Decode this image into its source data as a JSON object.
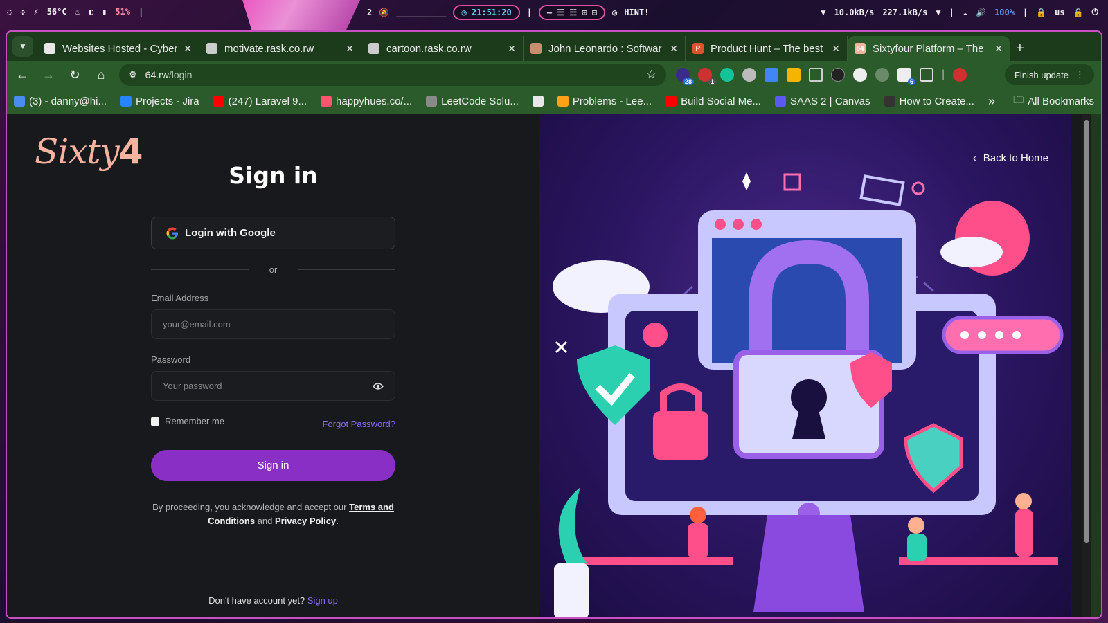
{
  "system_bar": {
    "temp": "56°C",
    "battery": "51%",
    "workspace": "2",
    "clock": "21:51:20",
    "hint": "HINT!",
    "net_up": "10.0kB/s",
    "net_down": "227.1kB/s",
    "volume": "100%",
    "layout": "us",
    "dashes": "__________"
  },
  "tabs": [
    {
      "title": "Websites Hosted - Cyber",
      "favicon": "doc-icon",
      "color": "#e8e8e8"
    },
    {
      "title": "motivate.rask.co.rw",
      "favicon": "globe-icon",
      "color": "#cccccc"
    },
    {
      "title": "cartoon.rask.co.rw",
      "favicon": "globe-icon",
      "color": "#cccccc"
    },
    {
      "title": "John Leonardo : Softwar",
      "favicon": "person-icon",
      "color": "#c89070"
    },
    {
      "title": "Product Hunt – The best",
      "favicon": "product-hunt-icon",
      "color": "#da552f",
      "letter": "P"
    },
    {
      "title": "Sixtyfour Platform – The",
      "favicon": "sixtyfour-icon",
      "color": "#f6b4a0",
      "letter": "64",
      "active": true
    }
  ],
  "toolbar": {
    "url_host": "64.rw",
    "url_path": "/login",
    "finish_update": "Finish update",
    "ext_badge_1": "28",
    "ext_badge_2": "1",
    "ext_badge_3": "6"
  },
  "bookmarks": [
    {
      "label": "(3) - danny@hi...",
      "color": "#4a8df0"
    },
    {
      "label": "Projects - Jira",
      "color": "#2684ff"
    },
    {
      "label": "(247) Laravel 9...",
      "color": "#ff0000"
    },
    {
      "label": "happyhues.co/...",
      "color": "#ff5470"
    },
    {
      "label": "LeetCode Solu...",
      "color": "#8a8a8a"
    },
    {
      "label": "",
      "color": "#e8e8e8"
    },
    {
      "label": "Problems - Lee...",
      "color": "#ffa116"
    },
    {
      "label": "Build Social Me...",
      "color": "#ff0000"
    },
    {
      "label": "SAAS 2 | Canvas",
      "color": "#5a5af0"
    },
    {
      "label": "How to Create...",
      "color": "#333333"
    }
  ],
  "all_bookmarks": "All Bookmarks",
  "page": {
    "logo_text": "Sixty",
    "logo_four": "4",
    "title": "Sign in",
    "google_label": "Login with Google",
    "divider": "or",
    "email_label": "Email Address",
    "email_placeholder": "your@email.com",
    "password_label": "Password",
    "password_placeholder": "Your password",
    "remember": "Remember me",
    "forgot": "Forgot Password?",
    "submit": "Sign in",
    "legal_prefix": "By proceeding, you acknowledge and accept our",
    "terms": "Terms and Conditions",
    "legal_and": "and",
    "privacy": "Privacy Policy",
    "legal_end": ".",
    "signup_prompt": "Don't have account yet?",
    "signup_link": "Sign up",
    "back_home": "Back to Home"
  },
  "colors": {
    "accent": "#8a2fc6",
    "link": "#8a6cf0",
    "logo": "#f6b4a0",
    "browser_chrome": "#2b5a2b"
  }
}
